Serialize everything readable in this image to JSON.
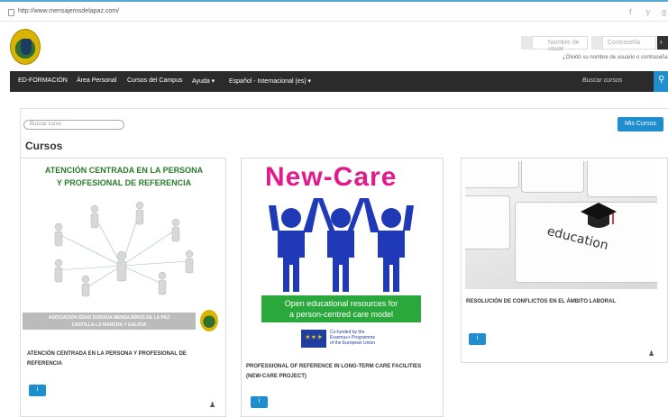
{
  "browser": {
    "url": "http://www.mensajerosdelapaz.com/"
  },
  "social": {
    "facebook": "f",
    "twitter": "𝕪",
    "other": "g"
  },
  "header": {
    "username_placeholder": "Nombre de usuar",
    "password_placeholder": "Contraseña",
    "forgot_link": "¿Olvidó su nombre de usuario o contraseña",
    "go_label": "›"
  },
  "nav": {
    "items": [
      "ED-FORMACIÓN",
      "Área Personal",
      "Cursos del Campus",
      "Ayuda ▾",
      "Español - Internacional (es) ▾"
    ],
    "search_placeholder": "Buscar cursos"
  },
  "main": {
    "course_search_placeholder": "Buscar curso",
    "my_courses_button": "Mis Cursos",
    "title": "Cursos"
  },
  "courses": [
    {
      "image_heading_line1": "ATENCIÓN CENTRADA EN LA PERSONA",
      "image_heading_line2": "Y PROFESIONAL DE REFERENCIA",
      "image_band_line1": "ASOCIACIÓN EDAD DORADA MENSAJEROS DE LA PAZ",
      "image_band_line2": "CASTILLA-LA MANCHA Y GALICIA",
      "title": "ATENCIÓN CENTRADA EN LA PERSONA Y PROFESIONAL DE REFERENCIA"
    },
    {
      "image_heading": "New-Care",
      "image_box_line1": "Open educational resources for",
      "image_box_line2": "a person-centred care model",
      "eu_line1": "Co-funded by the",
      "eu_line2": "Erasmus+ Programme",
      "eu_line3": "of the European Union",
      "title": "PROFESSIONAL OF REFERENCE IN LONG-TERM CARE FACILITIES (NEW-CARE PROJECT)"
    },
    {
      "image_text": "education",
      "title": "RESOLUCIÓN DE CONFLICTOS EN EL ÁMBITO LABORAL"
    }
  ],
  "icons": {
    "info": "i",
    "teacher": "♟",
    "search": "🔍",
    "user": "👤",
    "key": "🔑"
  },
  "colors": {
    "accent": "#1f8ecf",
    "nav_bg": "#2b2b2b",
    "newcare_pink": "#e21b8c",
    "green": "#2aa83b"
  }
}
